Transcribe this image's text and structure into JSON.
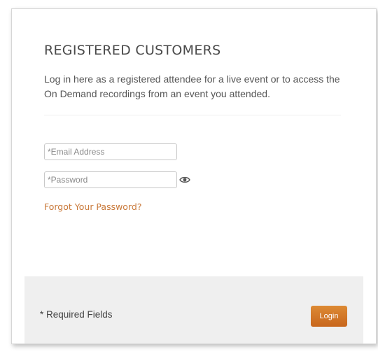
{
  "section": {
    "title": "REGISTERED CUSTOMERS",
    "description": "Log in here as a registered attendee for a live event or to access the On Demand recordings from an event you attended."
  },
  "form": {
    "email_placeholder": "*Email Address",
    "email_value": "",
    "password_placeholder": "*Password",
    "password_value": "",
    "show_password_icon": "eye-icon",
    "forgot_password_label": "Forgot Your Password?"
  },
  "footer": {
    "required_note": "* Required Fields",
    "login_label": "Login"
  },
  "colors": {
    "accent": "#c9793a",
    "button": "#d47a2a",
    "footer_bg": "#efefef"
  }
}
